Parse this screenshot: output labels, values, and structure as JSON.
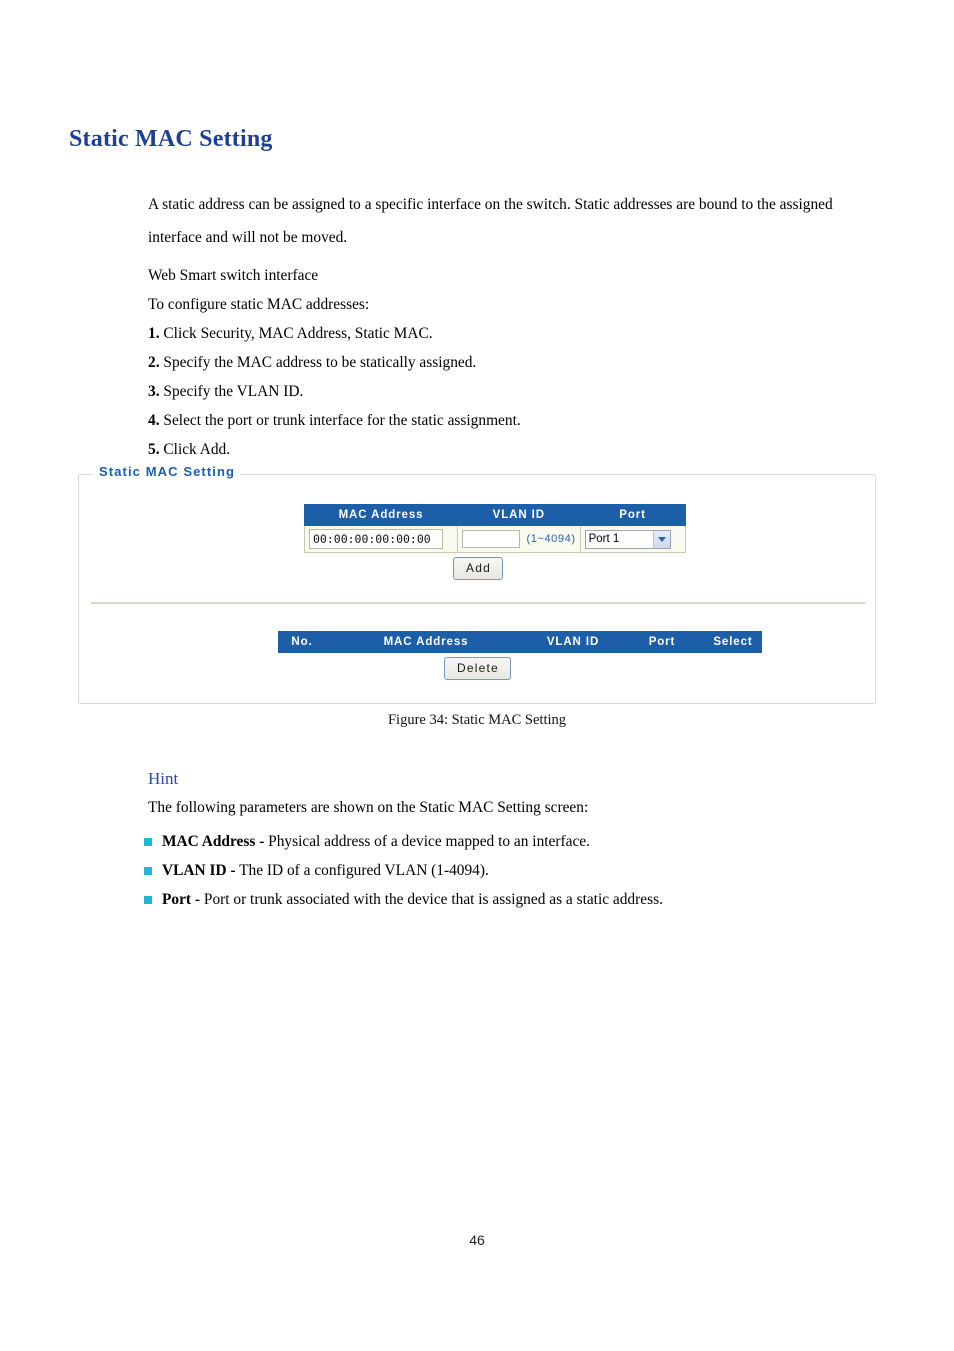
{
  "document": {
    "section_title": "Static MAC Setting",
    "intro_paragraph": "A static address can be assigned to a specific interface on the switch. Static addresses are bound to the assigned interface and will not be moved.",
    "interface_line": "Web Smart switch interface",
    "instructions_lead": "To configure static MAC addresses:",
    "steps": [
      {
        "number": "1.",
        "text": "Click Security, MAC Address, Static MAC."
      },
      {
        "number": "2.",
        "text": "Specify the MAC address to be statically assigned."
      },
      {
        "number": "3.",
        "text": "Specify the VLAN ID."
      },
      {
        "number": "4.",
        "text": "Select the port or trunk interface for the static assignment."
      },
      {
        "number": "5.",
        "text": "Click Add."
      }
    ],
    "figure_caption": "Figure 34: Static MAC Setting",
    "page_number": "46"
  },
  "figure": {
    "legend": "Static MAC Setting",
    "form": {
      "headers": [
        "MAC Address",
        "VLAN ID",
        "Port"
      ],
      "mac_value": "00:00:00:00:00:00",
      "vlan_value": "",
      "vlan_hint": "(1~4094)",
      "port_selected": "Port 1",
      "add_button": "Add"
    },
    "results": {
      "headers": [
        "No.",
        "MAC Address",
        "VLAN ID",
        "Port",
        "Select"
      ],
      "rows": [],
      "delete_button": "Delete"
    }
  },
  "hint": {
    "title": "Hint",
    "lead": "The following parameters are shown on the Static MAC Setting screen:",
    "items": [
      {
        "term": "MAC Address -",
        "desc": " Physical address of a device mapped to an interface."
      },
      {
        "term": "VLAN ID -",
        "desc": " The ID of a configured VLAN (1-4094)."
      },
      {
        "term": "Port -",
        "desc": " Port or trunk associated with the device that is assigned as a static address."
      }
    ]
  },
  "colors": {
    "heading_blue": "#1f3f94",
    "table_header_blue": "#1c5ea8",
    "bullet_cyan": "#1fb6d8",
    "hint_blue": "#2a4aa8",
    "field_row_bg": "#fbfaf0"
  }
}
